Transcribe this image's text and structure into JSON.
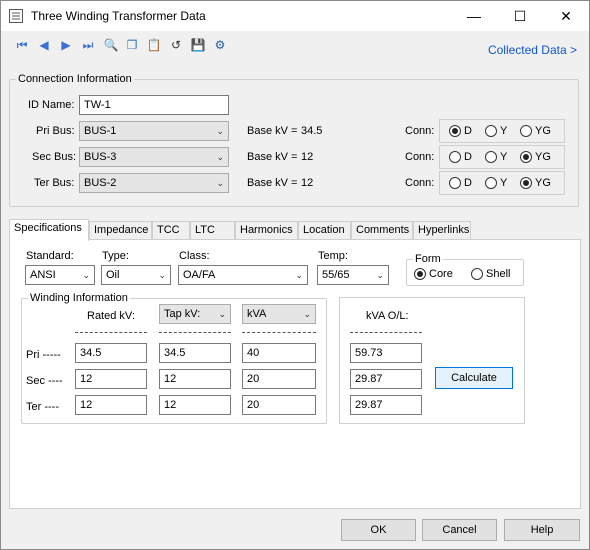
{
  "window": {
    "title": "Three Winding Transformer Data",
    "minimize": "—",
    "maximize": "☐",
    "close": "✕",
    "collected_data_link": "Collected Data >"
  },
  "toolbar": {
    "icons": [
      "first-icon",
      "prev-icon",
      "next-icon",
      "last-icon",
      "find-icon",
      "copy-icon",
      "paste-icon",
      "undo-icon",
      "save-icon",
      "settings-icon"
    ]
  },
  "connection": {
    "legend": "Connection Information",
    "id_label": "ID Name:",
    "id_value": "TW-1",
    "conn_label": "Conn:",
    "base_kv_label": "Base kV =",
    "conn_options": [
      "D",
      "Y",
      "YG"
    ],
    "rows": [
      {
        "label": "Pri Bus:",
        "bus": "BUS-1",
        "base_kv": "34.5",
        "selected": "D"
      },
      {
        "label": "Sec Bus:",
        "bus": "BUS-3",
        "base_kv": "12",
        "selected": "YG"
      },
      {
        "label": "Ter Bus:",
        "bus": "BUS-2",
        "base_kv": "12",
        "selected": "YG"
      }
    ]
  },
  "tabs": [
    "Specifications",
    "Impedance",
    "TCC",
    "LTC",
    "Harmonics",
    "Location",
    "Comments",
    "Hyperlinks"
  ],
  "specs": {
    "standard_label": "Standard:",
    "standard_value": "ANSI",
    "type_label": "Type:",
    "type_value": "Oil",
    "class_label": "Class:",
    "class_value": "OA/FA",
    "temp_label": "Temp:",
    "temp_value": "55/65",
    "form_legend": "Form",
    "form_options": [
      "Core",
      "Shell"
    ],
    "form_selected": "Core"
  },
  "winding": {
    "legend": "Winding Information",
    "rated_kv_label": "Rated kV:",
    "tap_kv_label": "Tap kV:",
    "kva_select_label": "kVA",
    "rows": [
      {
        "label": "Pri -----",
        "rated_kv": "34.5",
        "tap_kv": "34.5",
        "kva": "40"
      },
      {
        "label": "Sec ----",
        "rated_kv": "12",
        "tap_kv": "12",
        "kva": "20"
      },
      {
        "label": "Ter ----",
        "rated_kv": "12",
        "tap_kv": "12",
        "kva": "20"
      }
    ]
  },
  "overload": {
    "label": "kVA O/L:",
    "values": [
      "59.73",
      "29.87",
      "29.87"
    ],
    "calculate": "Calculate"
  },
  "footer": {
    "ok": "OK",
    "cancel": "Cancel",
    "help": "Help"
  }
}
